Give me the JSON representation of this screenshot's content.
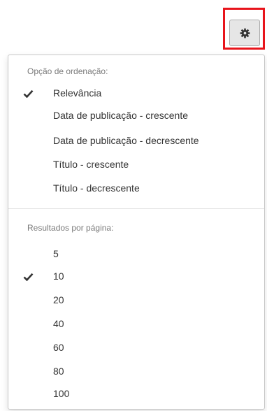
{
  "gear": {
    "icon": "gear-icon",
    "highlight_color": "#e8141b"
  },
  "sort": {
    "header": "Opção de ordenação:",
    "options": [
      {
        "label": "Relevância",
        "checked": true
      },
      {
        "label": "Data de publicação - crescente",
        "checked": false
      },
      {
        "label": "Data de publicação - decrescente",
        "checked": false
      },
      {
        "label": "Título - crescente",
        "checked": false
      },
      {
        "label": "Título - decrescente",
        "checked": false
      }
    ]
  },
  "per_page": {
    "header": "Resultados por página:",
    "options": [
      {
        "label": "5",
        "checked": false
      },
      {
        "label": "10",
        "checked": true
      },
      {
        "label": "20",
        "checked": false
      },
      {
        "label": "40",
        "checked": false
      },
      {
        "label": "60",
        "checked": false
      },
      {
        "label": "80",
        "checked": false
      },
      {
        "label": "100",
        "checked": false
      }
    ]
  }
}
